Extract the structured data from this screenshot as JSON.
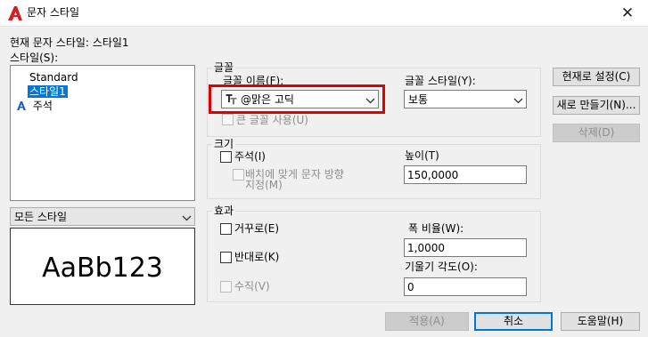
{
  "window": {
    "title": "문자 스타일",
    "close_glyph": "✕"
  },
  "current_style": {
    "label": "현재 문자 스타일:",
    "value": "스타일1"
  },
  "styles": {
    "label": "스타일(S):",
    "items": [
      {
        "label": "Standard",
        "selected": false,
        "annotative": false
      },
      {
        "label": "스타일1",
        "selected": true,
        "annotative": false
      },
      {
        "label": "주석",
        "selected": false,
        "annotative": true
      }
    ]
  },
  "filter": {
    "value": "모든 스타일"
  },
  "preview": {
    "text": "AaBb123"
  },
  "font_group": {
    "title": "글꼴",
    "font_name_label": "글꼴 이름(F):",
    "font_name_value": "@맑은 고딕",
    "font_style_label": "글꼴 스타일(Y):",
    "font_style_value": "보통",
    "big_font_label": "큰 글꼴 사용(U)"
  },
  "size_group": {
    "title": "크기",
    "annotative_label": "주석(I)",
    "match_label_line1": "배치에 맞게 문자 방향",
    "match_label_line2": "지정(M)",
    "height_label": "높이(T)",
    "height_value": "150,0000"
  },
  "effects_group": {
    "title": "효과",
    "upside_down_label": "거꾸로(E)",
    "backwards_label": "반대로(K)",
    "vertical_label": "수직(V)",
    "width_factor_label": "폭 비율(W):",
    "width_factor_value": "1,0000",
    "oblique_label": "기울기 각도(O):",
    "oblique_value": "0"
  },
  "side_buttons": {
    "set_current": "현재로 설정(C)",
    "new": "새로 만들기(N)...",
    "delete": "삭제(D)"
  },
  "bottom_buttons": {
    "apply": "적용(A)",
    "cancel": "취소",
    "help": "도움말(H)"
  },
  "colors": {
    "accent": "#0078d7",
    "highlight_box": "#e00000",
    "autocad_red": "#d42020"
  }
}
